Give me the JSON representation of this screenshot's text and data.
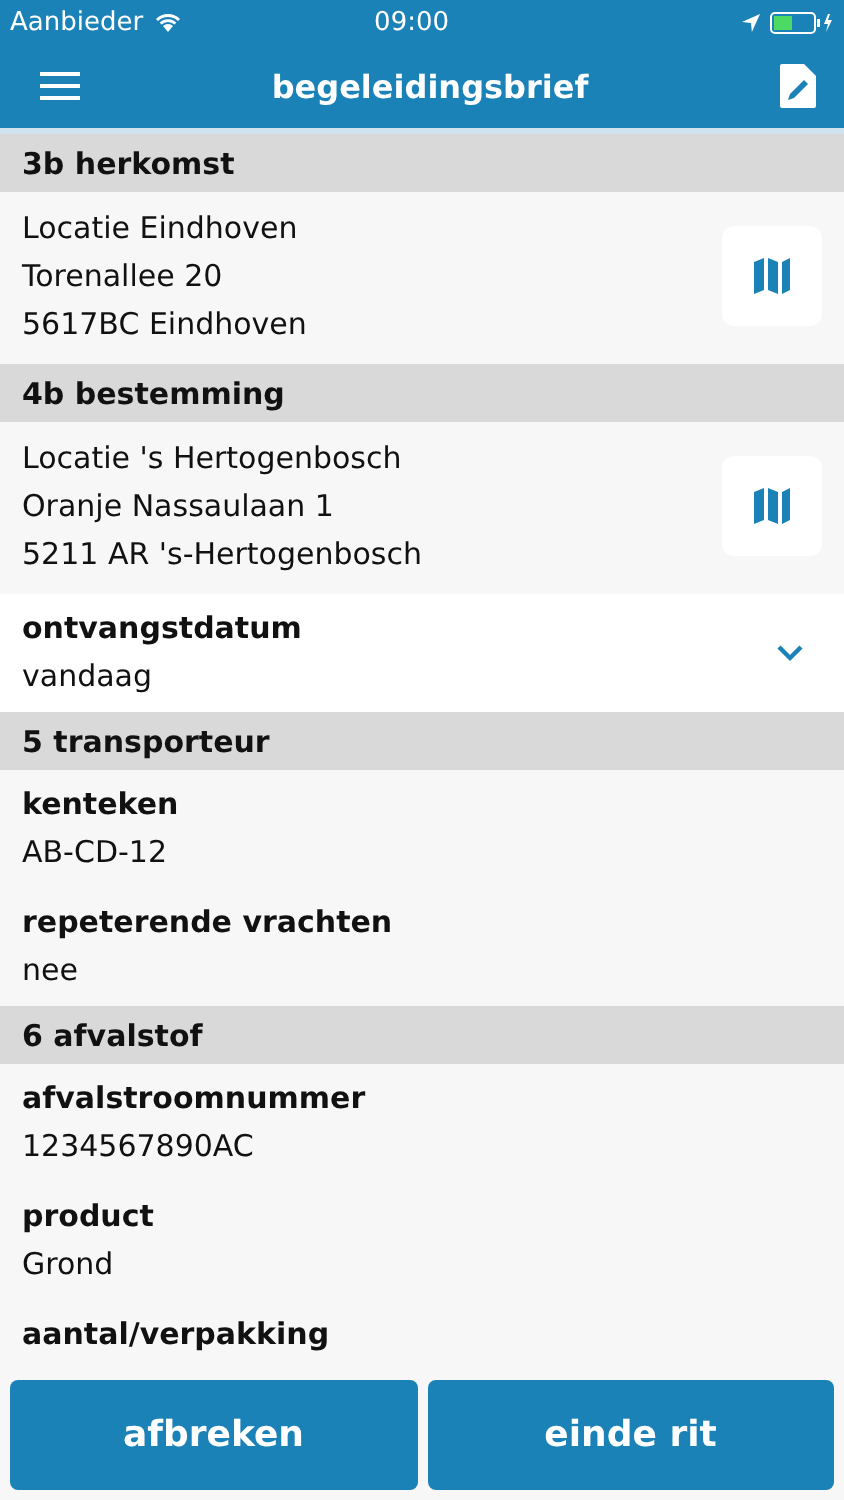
{
  "status_bar": {
    "carrier": "Aanbieder",
    "time": "09:00"
  },
  "nav": {
    "title": "begeleidingsbrief"
  },
  "sections": [
    {
      "title": "3b herkomst",
      "blocks": [
        {
          "kind": "address",
          "lines": [
            "Locatie Eindhoven",
            "Torenallee 20",
            "5617BC Eindhoven"
          ]
        }
      ]
    },
    {
      "title": "4b bestemming",
      "blocks": [
        {
          "kind": "address",
          "lines": [
            "Locatie 's Hertogenbosch",
            "Oranje Nassaulaan 1",
            "5211 AR 's-Hertogenbosch"
          ]
        },
        {
          "kind": "dropdown",
          "label": "ontvangstdatum",
          "value": "vandaag"
        }
      ]
    },
    {
      "title": "5 transporteur",
      "blocks": [
        {
          "kind": "field",
          "label": "kenteken",
          "value": "AB-CD-12"
        },
        {
          "kind": "field",
          "label": "repeterende vrachten",
          "value": "nee"
        }
      ]
    },
    {
      "title": "6 afvalstof",
      "blocks": [
        {
          "kind": "field",
          "label": "afvalstroomnummer",
          "value": "1234567890AC"
        },
        {
          "kind": "field",
          "label": "product",
          "value": "Grond"
        },
        {
          "kind": "field",
          "label": "aantal/verpakking"
        }
      ]
    }
  ],
  "buttons": [
    "afbreken",
    "einde rit"
  ]
}
